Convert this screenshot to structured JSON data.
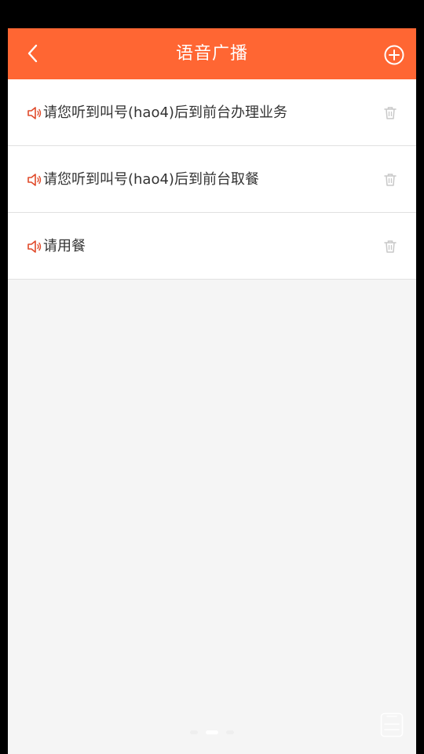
{
  "header": {
    "title": "语音广播",
    "back_icon": "chevron-left-icon",
    "add_icon": "plus-circle-icon"
  },
  "broadcasts": [
    {
      "text": "请您听到叫号(hao4)后到前台办理业务"
    },
    {
      "text": "请您听到叫号(hao4)后到前台取餐"
    },
    {
      "text": "请用餐"
    }
  ],
  "icons": {
    "speaker": "speaker-icon",
    "trash": "trash-icon",
    "floating": "clipboard-icon"
  },
  "colors": {
    "brand": "#ff6633",
    "speaker": "#e04a2a",
    "text": "#333333",
    "icon_gray": "#c8c8c8",
    "background": "#f5f5f5"
  },
  "pager": {
    "count": 3,
    "active": 2
  }
}
